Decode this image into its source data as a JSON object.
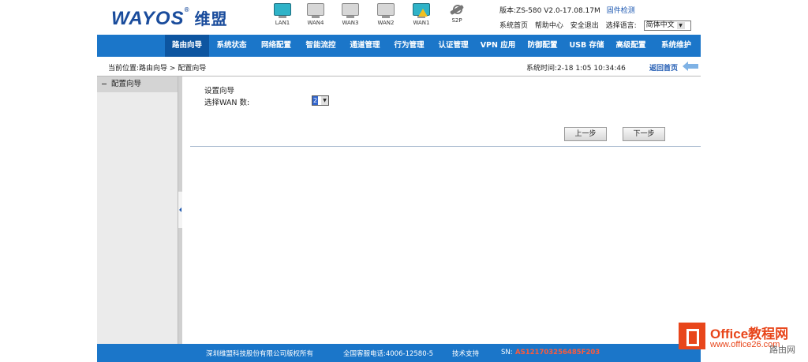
{
  "header": {
    "logo_text": "WAYOS",
    "logo_reg": "®",
    "logo_cn": "维盟",
    "ports": [
      {
        "label": "LAN1",
        "on": true,
        "warn": false
      },
      {
        "label": "WAN4",
        "on": false,
        "warn": false
      },
      {
        "label": "WAN3",
        "on": false,
        "warn": false
      },
      {
        "label": "WAN2",
        "on": false,
        "warn": false
      },
      {
        "label": "WAN1",
        "on": true,
        "warn": true
      },
      {
        "label": "S2P",
        "icon": "plug-icon"
      }
    ],
    "version": "版本:ZS-580 V2.0-17.08.17M",
    "upgrade": "固件检测",
    "links": [
      "系统首页",
      "帮助中心",
      "安全退出"
    ],
    "lang_label": "选择语言:",
    "lang_value": "简体中文"
  },
  "nav": [
    "路由向导",
    "系统状态",
    "网络配置",
    "智能流控",
    "通道管理",
    "行为管理",
    "认证管理",
    "VPN 应用",
    "防御配置",
    "USB 存储",
    "高级配置",
    "系统维护"
  ],
  "breadcrumb": {
    "location": "当前位置:路由向导 > 配置向导",
    "time": "系统时间:2-18 1:05 10:34:46",
    "back": "返回首页"
  },
  "sidebar": {
    "items": [
      {
        "label": "配置向导"
      }
    ]
  },
  "panel": {
    "title": "设置向导",
    "wan_label": "选择WAN 数:",
    "wan_value": "2",
    "prev": "上一步",
    "next": "下一步"
  },
  "footer": {
    "copyright": "深圳维盟科技股份有限公司版权所有",
    "hotline": "全国客服电话:4006-12580-5",
    "support": "技术支持",
    "sn_label": "SN:",
    "sn": "AS121703256485F203"
  },
  "watermark": {
    "brand": "Office教程网",
    "url": "www.office26.com",
    "extra": "路由网"
  },
  "colors": {
    "nav_bg": "#1b76c9",
    "nav_active": "#0d55a0",
    "logo": "#1a4c9c",
    "sn": "#ff5a3a",
    "watermark": "#e8461b"
  }
}
